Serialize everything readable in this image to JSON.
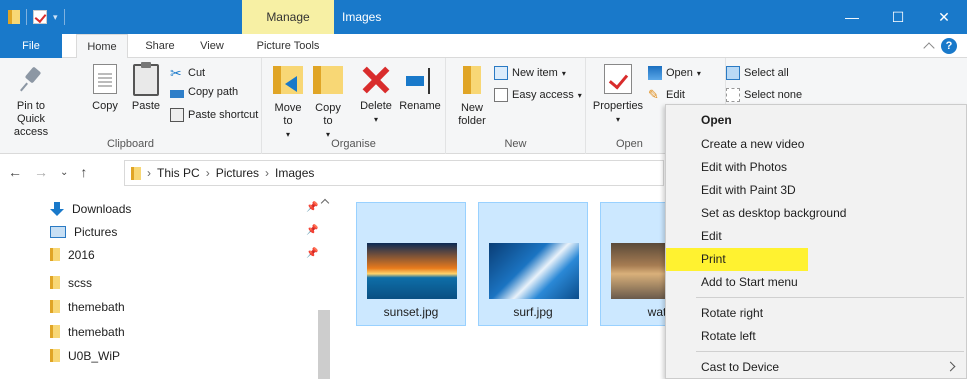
{
  "window": {
    "title": "Images",
    "contextual_tab_group": "Manage",
    "controls": {
      "minimize": "—",
      "maximize": "☐",
      "close": "✕"
    }
  },
  "tabs": {
    "file": "File",
    "home": "Home",
    "share": "Share",
    "view": "View",
    "picture_tools": "Picture Tools"
  },
  "ribbon": {
    "clipboard": {
      "label": "Clipboard",
      "pin": "Pin to Quick access",
      "copy": "Copy",
      "paste": "Paste",
      "cut": "Cut",
      "copy_path": "Copy path",
      "paste_shortcut": "Paste shortcut"
    },
    "organise": {
      "label": "Organise",
      "move_to": "Move to",
      "copy_to": "Copy to",
      "delete": "Delete",
      "rename": "Rename"
    },
    "new": {
      "label": "New",
      "new_folder": "New folder",
      "new_item": "New item",
      "easy_access": "Easy access"
    },
    "open": {
      "label": "Open",
      "properties": "Properties",
      "open": "Open",
      "edit": "Edit"
    },
    "select": {
      "select_all": "Select all",
      "select_none": "Select none"
    }
  },
  "address": {
    "crumbs": [
      "This PC",
      "Pictures",
      "Images"
    ]
  },
  "sidebar": {
    "items": [
      {
        "label": "Downloads",
        "icon": "download-icon",
        "pinned": true
      },
      {
        "label": "Pictures",
        "icon": "pictures-icon",
        "pinned": true
      },
      {
        "label": "2016",
        "icon": "folder-icon",
        "pinned": true
      },
      {
        "label": "scss",
        "icon": "folder-icon",
        "pinned": false
      },
      {
        "label": "themebath",
        "icon": "folder-icon",
        "pinned": false
      },
      {
        "label": "themebath",
        "icon": "folder-icon",
        "pinned": false
      },
      {
        "label": "U0B_WiP",
        "icon": "folder-icon",
        "pinned": false
      }
    ]
  },
  "files": [
    {
      "name": "sunset.jpg"
    },
    {
      "name": "surf.jpg"
    },
    {
      "name": "water.j"
    }
  ],
  "context_menu": {
    "items": [
      "Open",
      "Create a new video",
      "Edit with Photos",
      "Edit with Paint 3D",
      "Set as desktop background",
      "Edit",
      "Print",
      "Add to Start menu",
      "Rotate right",
      "Rotate left",
      "Cast to Device"
    ],
    "highlighted": "Print",
    "highlight_color": "#fff230"
  },
  "colors": {
    "titlebar": "#1979ca",
    "manage_tab": "#f7f0a4",
    "selection": "#cce8ff"
  }
}
